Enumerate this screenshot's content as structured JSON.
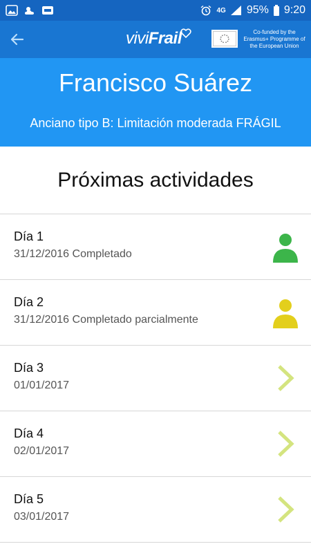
{
  "status_bar": {
    "battery": "95%",
    "time": "9:20",
    "network": "4G"
  },
  "app_bar": {
    "logo_light": "vivi",
    "logo_bold": "Frail",
    "eu_text": "Co-funded by the Erasmus+ Programme of the European Union"
  },
  "profile": {
    "name": "Francisco Suárez",
    "type": "Anciano tipo B: Limitación moderada FRÁGIL"
  },
  "section": {
    "title": "Próximas actividades"
  },
  "activities": [
    {
      "day": "Día 1",
      "subtitle": "31/12/2016 Completado",
      "icon": "person-icon",
      "color": "#3cb54a"
    },
    {
      "day": "Día 2",
      "subtitle": "31/12/2016 Completado parcialmente",
      "icon": "person-icon",
      "color": "#e3cf1c"
    },
    {
      "day": "Día 3",
      "subtitle": "01/01/2017",
      "icon": "chevron-right-icon",
      "color": "#d4e47f"
    },
    {
      "day": "Día 4",
      "subtitle": "02/01/2017",
      "icon": "chevron-right-icon",
      "color": "#d4e47f"
    },
    {
      "day": "Día 5",
      "subtitle": "03/01/2017",
      "icon": "chevron-right-icon",
      "color": "#d4e47f"
    }
  ],
  "colors": {
    "status_bar": "#1565c0",
    "app_bar": "#1976d2",
    "profile_bg": "#2196f3"
  }
}
